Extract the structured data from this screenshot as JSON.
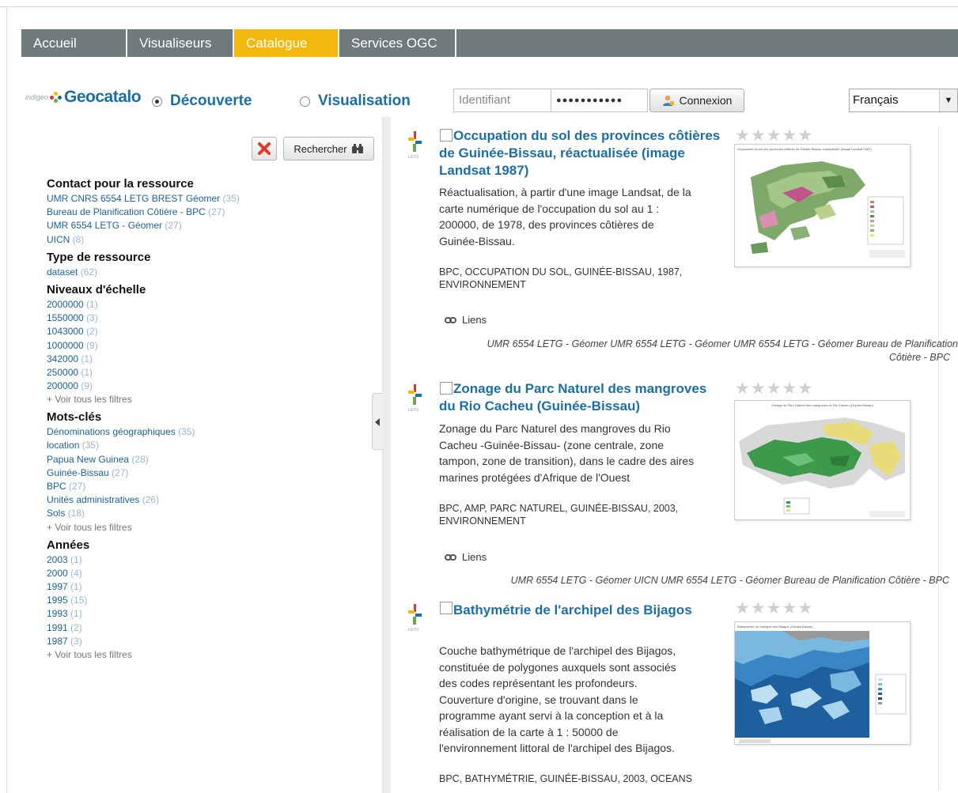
{
  "nav": {
    "tabs": [
      {
        "label": "Accueil"
      },
      {
        "label": "Visualiseurs"
      },
      {
        "label": "Catalogue"
      },
      {
        "label": "Services OGC"
      }
    ],
    "active_color": "#f2b80e"
  },
  "header": {
    "logo_prefix": "indigeo",
    "logo_text": "Geocatalo",
    "mode_discover": "Découverte",
    "mode_visualize": "Visualisation",
    "login_placeholder": "Identifiant",
    "password_mask": "●●●●●●●●●●●",
    "login_button": "Connexion",
    "language": "Français"
  },
  "search": {
    "clear_icon": "red-x-icon",
    "search_label": "Rechercher"
  },
  "facets": {
    "contact": {
      "title": "Contact pour la ressource",
      "items": [
        {
          "label": "UMR CNRS 6554 LETG BREST Géomer",
          "count": "(35)"
        },
        {
          "label": "Bureau de Planification Côtière - BPC",
          "count": "(27)"
        },
        {
          "label": "UMR 6554 LETG - Géomer",
          "count": "(27)"
        },
        {
          "label": "UICN",
          "count": "(8)"
        }
      ]
    },
    "type": {
      "title": "Type de ressource",
      "items": [
        {
          "label": "dataset",
          "count": "(62)"
        }
      ]
    },
    "scale": {
      "title": "Niveaux d'échelle",
      "items": [
        {
          "label": "2000000",
          "count": "(1)"
        },
        {
          "label": "1550000",
          "count": "(3)"
        },
        {
          "label": "1043000",
          "count": "(2)"
        },
        {
          "label": "1000000",
          "count": "(9)"
        },
        {
          "label": "342000",
          "count": "(1)"
        },
        {
          "label": "250000",
          "count": "(1)"
        },
        {
          "label": "200000",
          "count": "(9)"
        }
      ],
      "more": "+ Voir tous les filtres"
    },
    "keywords": {
      "title": "Mots-clés",
      "items": [
        {
          "label": "Dénominations géographiques",
          "count": "(35)"
        },
        {
          "label": "location",
          "count": "(35)"
        },
        {
          "label": "Papua New Guinea",
          "count": "(28)"
        },
        {
          "label": "Guinée-Bissau",
          "count": "(27)"
        },
        {
          "label": "BPC",
          "count": "(27)"
        },
        {
          "label": "Unités administratives",
          "count": "(26)"
        },
        {
          "label": "Sols",
          "count": "(18)"
        }
      ],
      "more": "+ Voir tous les filtres"
    },
    "years": {
      "title": "Années",
      "items": [
        {
          "label": "2003",
          "count": "(1)"
        },
        {
          "label": "2000",
          "count": "(4)"
        },
        {
          "label": "1997",
          "count": "(1)"
        },
        {
          "label": "1995",
          "count": "(15)"
        },
        {
          "label": "1993",
          "count": "(1)"
        },
        {
          "label": "1991",
          "count": "(2)"
        },
        {
          "label": "1987",
          "count": "(3)"
        }
      ],
      "more": "+ Voir tous les filtres"
    }
  },
  "results": [
    {
      "title_lines": [
        "Occupation du sol des provinces côtières",
        "de Guinée-Bissau, réactualisée (image",
        "Landsat 1987)"
      ],
      "abstract_lines": [
        "Réactualisation, à partir d'une image Landsat, de la",
        "carte numérique de l'occupation du sol au 1 :",
        "200000, de 1978, des provinces côtières de",
        "Guinée-Bissau."
      ],
      "keyword_lines": [
        "BPC, OCCUPATION DU SOL, GUINÉE-BISSAU, 1987,",
        "ENVIRONNEMENT"
      ],
      "links_label": "Liens",
      "contacts_lines": [
        "UMR 6554 LETG - Géomer   UMR 6554 LETG - Géomer   UMR 6554 LETG - Géomer   Bureau de Planification",
        "Côtière - BPC"
      ],
      "thumb_caption": "Occupation du sol des provinces côtières de Guinée-Bissau, réactualisée (image Landsat 1987)"
    },
    {
      "title_lines": [
        "Zonage du Parc Naturel des mangroves",
        "du Rio Cacheu (Guinée-Bissau)"
      ],
      "abstract_lines": [
        "Zonage du Parc Naturel des mangroves du Rio",
        "Cacheu -Guinée-Bissau- (zone centrale, zone",
        "tampon, zone de transition), dans le cadre des aires",
        "marines protégées d'Afrique de l'Ouest"
      ],
      "keyword_lines": [
        "BPC, AMP, PARC NATUREL, GUINÉE-BISSAU, 2003,",
        "ENVIRONNEMENT"
      ],
      "links_label": "Liens",
      "contacts_lines": [
        "UMR 6554 LETG - Géomer   UICN   UMR 6554 LETG - Géomer   Bureau de Planification Côtière - BPC"
      ],
      "thumb_caption": "Zonage du Parc Naturel des mangroves du Rio Cacheu (Guinée-Bissau)"
    },
    {
      "title_lines": [
        "Bathymétrie de l'archipel des Bijagos"
      ],
      "abstract_lines": [
        "Couche bathymétrique de l'archipel des Bijagos,",
        "constituée de polygones auxquels sont associés",
        "des codes représentant les profondeurs.",
        "Couverture d'origine, se trouvant dans le",
        "programme ayant servi à la conception et à la",
        "réalisation de la carte à 1 : 50000 de",
        "l'environnement littoral de l'archipel des Bijagos."
      ],
      "keyword_lines": [
        "BPC, BATHYMÉTRIE, GUINÉE-BISSAU, 2003, OCEANS"
      ],
      "thumb_caption": "Bathymétrie de l'archipel des Bijagos (Guinée-Bissau)"
    }
  ]
}
